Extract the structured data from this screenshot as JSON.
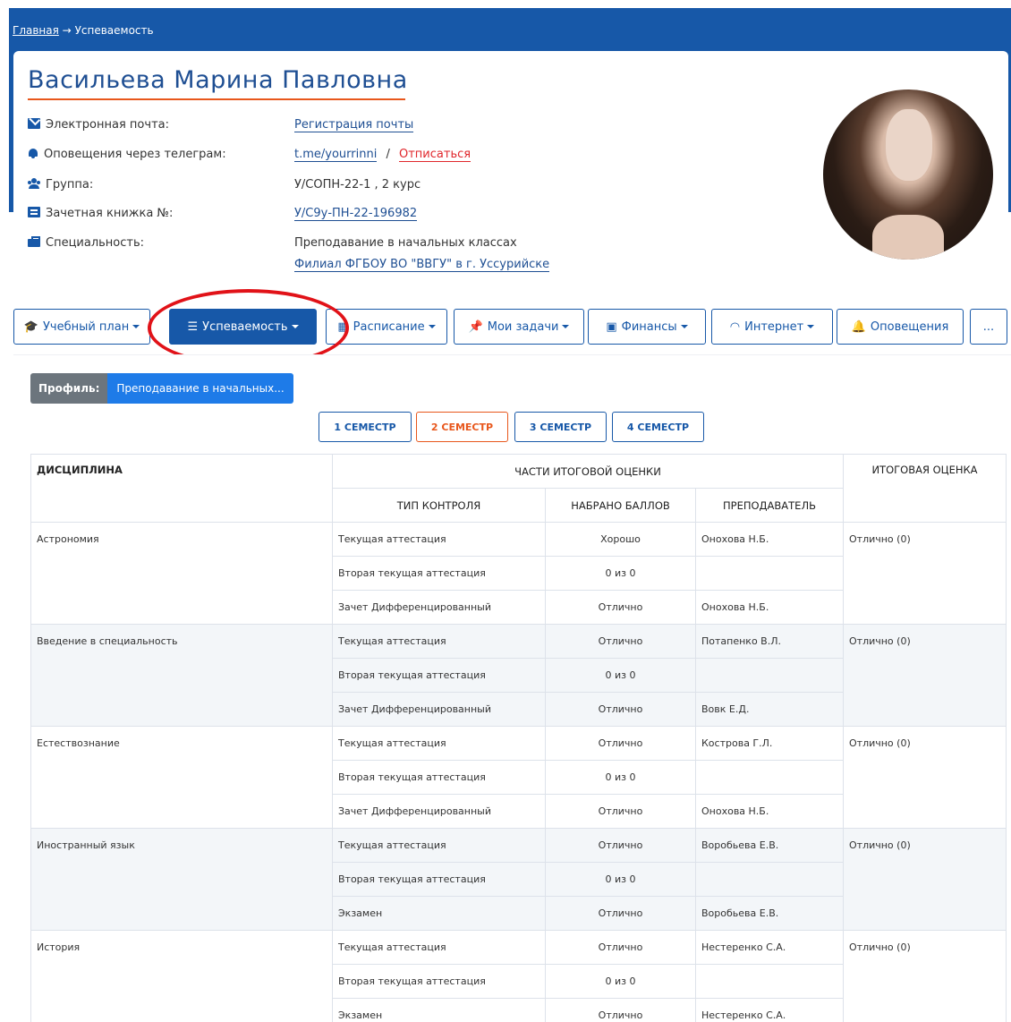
{
  "breadcrumb": {
    "home": "Главная",
    "arrow": "→",
    "current": "Успеваемость"
  },
  "student": {
    "name": "Васильева Марина Павловна",
    "fields": [
      {
        "label": "Электронная почта:",
        "icon": "envelope-icon"
      },
      {
        "label": "Оповещения через телеграм:",
        "icon": "bell-icon"
      },
      {
        "label": "Группа:",
        "icon": "users-icon"
      },
      {
        "label": "Зачетная книжка №:",
        "icon": "book-icon"
      },
      {
        "label": "Специальность:",
        "icon": "briefcase-icon"
      }
    ],
    "email_link": "Регистрация почты",
    "telegram_link": "t.me/yourrinni",
    "telegram_sep": "/",
    "unsubscribe": "Отписаться",
    "group": "У/СОПН-22-1 , 2 курс",
    "record_book": "У/С9у-ПН-22-196982",
    "specialty": "Преподавание в начальных классах",
    "branch": "Филиал ФГБОУ ВО \"ВВГУ\" в г. Уссурийске"
  },
  "tabs": [
    {
      "label": "Учебный план",
      "icon": "graduation-cap-icon"
    },
    {
      "label": "Успеваемость",
      "icon": "list-check-icon"
    },
    {
      "label": "Расписание",
      "icon": "calendar-icon"
    },
    {
      "label": "Мои задачи",
      "icon": "pin-icon"
    },
    {
      "label": "Финансы",
      "icon": "money-icon"
    },
    {
      "label": "Интернет",
      "icon": "wifi-icon"
    },
    {
      "label": "Оповещения",
      "icon": "bell-icon"
    },
    {
      "label": "...",
      "icon": ""
    }
  ],
  "profile": {
    "label": "Профиль:",
    "value": "Преподавание в начальных..."
  },
  "semesters": [
    "1 СЕМЕСТР",
    "2 СЕМЕСТР",
    "3 СЕМЕСТР",
    "4 СЕМЕСТР"
  ],
  "table": {
    "headers": {
      "discipline": "ДИСЦИПЛИНА",
      "parts": "ЧАСТИ ИТОГОВОЙ ОЦЕНКИ",
      "type": "ТИП КОНТРОЛЯ",
      "score": "НАБРАНО БАЛЛОВ",
      "teacher": "ПРЕПОДАВАТЕЛЬ",
      "final": "ИТОГОВАЯ ОЦЕНКА"
    },
    "subjects": [
      {
        "name": "Астрономия",
        "final": "Отлично (0)",
        "rows": [
          [
            "Текущая аттестация",
            "Хорошо",
            "Онохова Н.Б."
          ],
          [
            "Вторая текущая аттестация",
            "0 из 0",
            ""
          ],
          [
            "Зачет Дифференцированный",
            "Отлично",
            "Онохова Н.Б."
          ]
        ]
      },
      {
        "name": "Введение в специальность",
        "final": "Отлично (0)",
        "rows": [
          [
            "Текущая аттестация",
            "Отлично",
            "Потапенко В.Л."
          ],
          [
            "Вторая текущая аттестация",
            "0 из 0",
            ""
          ],
          [
            "Зачет Дифференцированный",
            "Отлично",
            "Вовк Е.Д."
          ]
        ]
      },
      {
        "name": "Естествознание",
        "final": "Отлично (0)",
        "rows": [
          [
            "Текущая аттестация",
            "Отлично",
            "Кострова Г.Л."
          ],
          [
            "Вторая текущая аттестация",
            "0 из 0",
            ""
          ],
          [
            "Зачет Дифференцированный",
            "Отлично",
            "Онохова Н.Б."
          ]
        ]
      },
      {
        "name": "Иностранный язык",
        "final": "Отлично (0)",
        "rows": [
          [
            "Текущая аттестация",
            "Отлично",
            "Воробьева Е.В."
          ],
          [
            "Вторая текущая аттестация",
            "0 из 0",
            ""
          ],
          [
            "Экзамен",
            "Отлично",
            "Воробьева Е.В."
          ]
        ]
      },
      {
        "name": "История",
        "final": "Отлично (0)",
        "rows": [
          [
            "Текущая аттестация",
            "Отлично",
            "Нестеренко С.А."
          ],
          [
            "Вторая текущая аттестация",
            "0 из 0",
            ""
          ],
          [
            "Экзамен",
            "Отлично",
            "Нестеренко С.А."
          ]
        ]
      }
    ]
  },
  "colors": {
    "brand": "#1758a8",
    "accent": "#e8571c",
    "highlight": "#e11218"
  }
}
